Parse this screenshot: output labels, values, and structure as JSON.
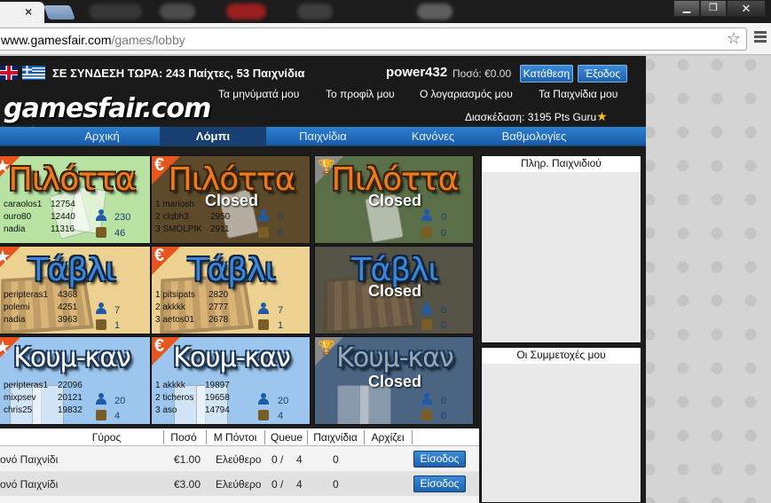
{
  "browser": {
    "tab_close": "×",
    "url_host": "www.gamesfair.com",
    "url_path": "/games/lobby",
    "window_buttons": [
      "▁",
      "❐",
      "✕"
    ]
  },
  "header": {
    "online_text": "ΣΕ ΣΥΝΔΕΣΗ ΤΩΡΑ: 243 Παίχτες, 53 Παιχνίδια",
    "username": "power432",
    "balance": "Ποσό: €0.00",
    "deposit_label": "Κατάθεση",
    "logout_label": "Έξοδος",
    "links": [
      "Τα μηνύματά μου",
      "Το προφίλ μου",
      "Ο λογαριασμός μου",
      "Τα Παιχνίδια μου"
    ],
    "logo_text": "gamesfair.com",
    "fun_text": "Διασκέδαση: 3195 Pts Guru"
  },
  "nav": {
    "items": [
      "Αρχική",
      "Λόμπι",
      "Παιχνίδια",
      "Κανόνες",
      "Βαθμολογίες"
    ],
    "active": "Λόμπι"
  },
  "tiles": [
    {
      "title": "Πιλόττα",
      "badge": "★",
      "closed": "",
      "leaders": [
        [
          "caraolos1",
          "12754"
        ],
        [
          "ouro80",
          "12440"
        ],
        [
          "nadia",
          "11316"
        ]
      ],
      "players": "230",
      "games": "46"
    },
    {
      "title": "Πιλόττα",
      "badge": "€",
      "closed": "Closed",
      "leaders": [
        [
          "1 mariosh",
          ""
        ],
        [
          "2 clqbh3",
          "2950"
        ],
        [
          "3 SMOLPIK",
          "2911"
        ]
      ],
      "players": "0",
      "games": "0"
    },
    {
      "title": "Πιλόττα",
      "badge": "🏆",
      "closed": "Closed",
      "leaders": [],
      "players": "0",
      "games": "0"
    },
    {
      "title": "Τάβλι",
      "badge": "★",
      "closed": "",
      "leaders": [
        [
          "peripteras1",
          "4368"
        ],
        [
          "polemi",
          "4251"
        ],
        [
          "nadia",
          "3963"
        ]
      ],
      "players": "7",
      "games": "1"
    },
    {
      "title": "Τάβλι",
      "badge": "€",
      "closed": "",
      "leaders": [
        [
          "1 pitsipats",
          "2820"
        ],
        [
          "2 akkkk",
          "2777"
        ],
        [
          "3 aetos01",
          "2678"
        ]
      ],
      "players": "7",
      "games": "1"
    },
    {
      "title": "Τάβλι",
      "badge": "",
      "closed": "Closed",
      "leaders": [],
      "players": "0",
      "games": "0"
    },
    {
      "title": "Κουμ-καν",
      "badge": "★",
      "closed": "",
      "leaders": [
        [
          "peripteras1",
          "22096"
        ],
        [
          "mixpsev",
          "20121"
        ],
        [
          "chris25",
          "19832"
        ]
      ],
      "players": "20",
      "games": "4"
    },
    {
      "title": "Κουμ-καν",
      "badge": "€",
      "closed": "",
      "leaders": [
        [
          "1 akkkk",
          "19897"
        ],
        [
          "2 ticheros",
          "19658"
        ],
        [
          "3 aso",
          "14794"
        ]
      ],
      "players": "20",
      "games": "4"
    },
    {
      "title": "Κουμ-καν",
      "badge": "🏆",
      "closed": "Closed",
      "leaders": [],
      "players": "0",
      "games": "0"
    }
  ],
  "panels": {
    "game_info_title": "Πληρ. Παιχνιδιού",
    "my_entries_title": "Οι Συμμετοχές μου"
  },
  "table": {
    "headers": [
      "Γύρος",
      "Ποσό",
      "Μ Πόντοι",
      "Queue",
      "Παιχνίδια",
      "Αρχίζει"
    ],
    "rows": [
      {
        "round": "ονό Παιχνίδι",
        "amount": "€1.00",
        "points": "Ελεύθερο",
        "queue_a": "0 /",
        "queue_b": "4",
        "games": "0",
        "action": "Είσοδος"
      },
      {
        "round": "ονό Παιχνίδι",
        "amount": "€3.00",
        "points": "Ελεύθερο",
        "queue_a": "0 /",
        "queue_b": "4",
        "games": "0",
        "action": "Είσοδος"
      }
    ]
  },
  "colors": {
    "nav_blue": "#2b7fd1",
    "accent_orange": "#f07a1a",
    "header_bg": "#1a1a1a"
  }
}
